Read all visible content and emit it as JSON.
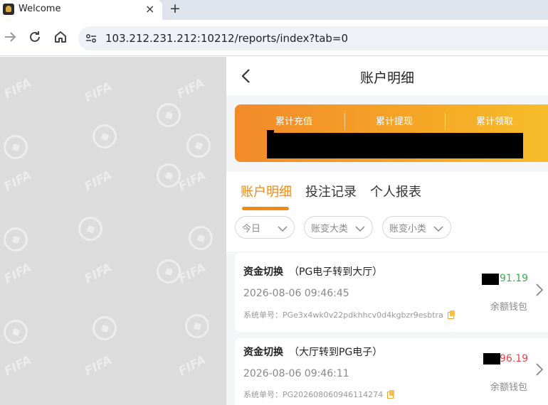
{
  "browser": {
    "tab_title": "Welcome",
    "tab_close": "×",
    "new_tab": "+",
    "url": "103.212.231.212:10212/reports/index?tab=0"
  },
  "background": {
    "watermark": "FIFA"
  },
  "app": {
    "title": "账户明细",
    "summary": {
      "labels": [
        "累计充值",
        "累计提现",
        "累计领取"
      ]
    },
    "tabs": [
      {
        "label": "账户明细",
        "active": true
      },
      {
        "label": "投注记录",
        "active": false
      },
      {
        "label": "个人报表",
        "active": false
      }
    ],
    "filters": [
      {
        "label": "今日"
      },
      {
        "label": "账变大类"
      },
      {
        "label": "账变小类"
      }
    ],
    "records": [
      {
        "title": "资金切换",
        "subtitle": "（PG电子转到大厅）",
        "time": "2026-08-06 09:46:45",
        "order_label": "系统单号：",
        "order_no": "PGe3x4wk0v22pdkhhcv0d4kgbzr9esbtra",
        "amount": "91.19",
        "amount_color": "#3fae4f",
        "wallet": "余额钱包"
      },
      {
        "title": "资金切换",
        "subtitle": "（大厅转到PG电子）",
        "time": "2026-08-06 09:46:11",
        "order_label": "系统单号：",
        "order_no": "PG202608060946114274",
        "amount": "96.19",
        "amount_color": "#e84545",
        "wallet": "余额钱包"
      }
    ]
  }
}
